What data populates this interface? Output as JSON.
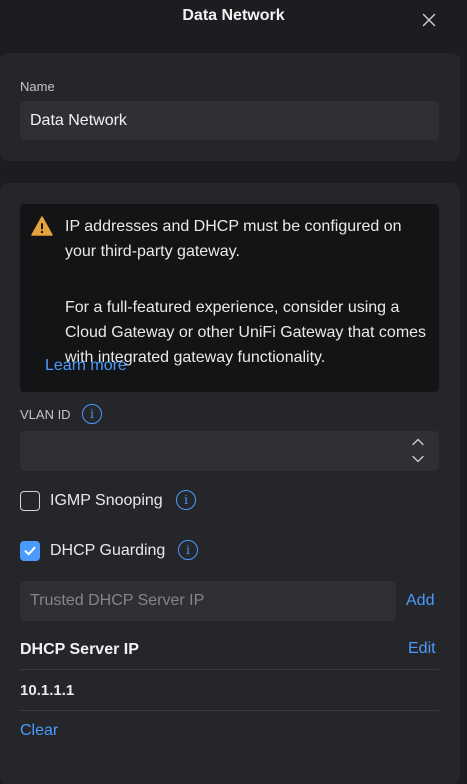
{
  "header": {
    "title": "Data Network",
    "close_icon": "close-icon"
  },
  "name_section": {
    "label": "Name",
    "value": "Data Network"
  },
  "notice": {
    "icon": "warning-icon",
    "icon_color": "#e8a23a",
    "paragraph_1": "IP addresses and DHCP must be configured on your third-party gateway.",
    "paragraph_2": "For a full-featured experience, consider using a Cloud Gateway or other UniFi Gateway that comes with integrated gateway functionality.",
    "link": "Learn more"
  },
  "vlan": {
    "label": "VLAN ID",
    "value": "",
    "info_icon": "info-icon"
  },
  "igmp_snooping": {
    "label": "IGMP Snooping",
    "checked": false
  },
  "dhcp_guarding": {
    "label": "DHCP Guarding",
    "checked": true
  },
  "trusted_server": {
    "placeholder": "Trusted DHCP Server IP",
    "add_label": "Add"
  },
  "dhcp_server": {
    "title": "DHCP Server IP",
    "edit_label": "Edit",
    "ips": [
      "10.1.1.1"
    ],
    "clear_label": "Clear"
  },
  "colors": {
    "accent": "#4b9bff",
    "background": "#1c1d20",
    "card": "#252629"
  }
}
